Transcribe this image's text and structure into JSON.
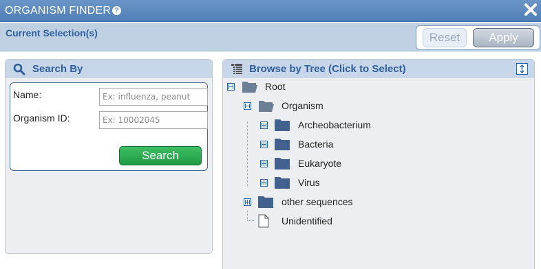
{
  "window": {
    "title": "ORGANISM FINDER",
    "help_icon_glyph": "?",
    "close_icon": "close-icon"
  },
  "selection": {
    "label": "Current Selection(s)",
    "reset_label": "Reset",
    "apply_label": "Apply",
    "reset_enabled": false
  },
  "search_panel": {
    "title": "Search By",
    "icon": "search-icon",
    "name_label": "Name:",
    "name_placeholder": "Ex: influenza, peanut",
    "name_value": "",
    "id_label": "Organism ID:",
    "id_placeholder": "Ex: 10002045",
    "id_value": "",
    "search_label": "Search"
  },
  "tree_panel": {
    "title": "Browse by Tree (Click to Select)",
    "icon": "tree-list-icon",
    "expand_icon": "expand-icon",
    "nodes": [
      {
        "label": "Root",
        "state": "expanded",
        "kind": "open-folder"
      },
      {
        "label": "Organism",
        "state": "expanded",
        "kind": "open-folder"
      },
      {
        "label": "Archeobacterium",
        "state": "collapsed",
        "kind": "folder"
      },
      {
        "label": "Bacteria",
        "state": "collapsed",
        "kind": "folder"
      },
      {
        "label": "Eukaryote",
        "state": "collapsed",
        "kind": "folder"
      },
      {
        "label": "Virus",
        "state": "collapsed",
        "kind": "folder"
      },
      {
        "label": "other sequences",
        "state": "collapsed",
        "kind": "folder"
      },
      {
        "label": "Unidentified",
        "state": "leaf",
        "kind": "document"
      }
    ]
  },
  "colors": {
    "header_blue": "#4f7fb8",
    "accent_text": "#2f5f9e",
    "search_green": "#1f9a43",
    "folder_blue": "#43618f"
  }
}
